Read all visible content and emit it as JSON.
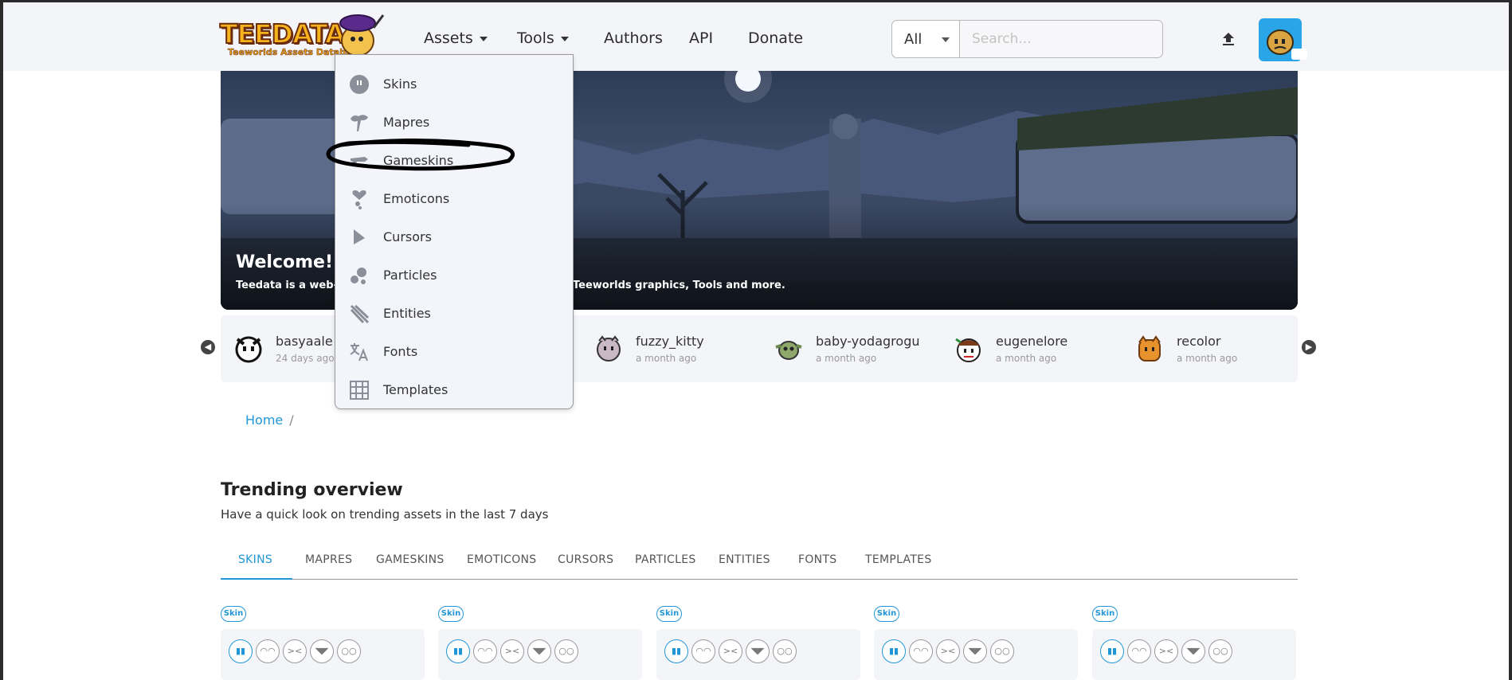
{
  "header": {
    "logo_text": "TEEDATA",
    "logo_subtext": "Teeworlds Assets Database",
    "nav": {
      "assets": "Assets",
      "tools": "Tools",
      "authors": "Authors",
      "api": "API",
      "donate": "Donate"
    },
    "search": {
      "category_value": "All",
      "placeholder": "Search..."
    }
  },
  "hero": {
    "title": "Welcome!",
    "text_left": "Teedata is a web-b",
    "text_right": "Teeworlds graphics, Tools and more."
  },
  "recent": [
    {
      "name": "basyaale",
      "time": "24 days ago"
    },
    {
      "name": "fuzzy_kitty",
      "time": "a month ago"
    },
    {
      "name": "baby-yodagrogu",
      "time": "a month ago"
    },
    {
      "name": "eugenelore",
      "time": "a month ago"
    },
    {
      "name": "recolor",
      "time": "a month ago"
    }
  ],
  "dropdown": {
    "items": [
      {
        "label": "Skins",
        "icon": "skin-icon"
      },
      {
        "label": "Mapres",
        "icon": "tree-icon"
      },
      {
        "label": "Gameskins",
        "icon": "gun-icon"
      },
      {
        "label": "Emoticons",
        "icon": "heart-icon"
      },
      {
        "label": "Cursors",
        "icon": "cursor-icon"
      },
      {
        "label": "Particles",
        "icon": "particles-icon"
      },
      {
        "label": "Entities",
        "icon": "entities-icon"
      },
      {
        "label": "Fonts",
        "icon": "translate-icon"
      },
      {
        "label": "Templates",
        "icon": "grid-icon"
      }
    ]
  },
  "breadcrumb": {
    "home": "Home",
    "separator": "/"
  },
  "trending": {
    "title": "Trending overview",
    "subtitle": "Have a quick look on trending assets in the last 7 days",
    "tabs": [
      "SKINS",
      "MAPRES",
      "GAMESKINS",
      "EMOTICONS",
      "CURSORS",
      "PARTICLES",
      "ENTITIES",
      "FONTS",
      "TEMPLATES"
    ],
    "active_tab": "SKINS",
    "card_tag": "Skin"
  },
  "colors": {
    "accent": "#2196d6",
    "header_bg": "#f4f5f9",
    "avatar_bg": "#2aa6e8"
  }
}
